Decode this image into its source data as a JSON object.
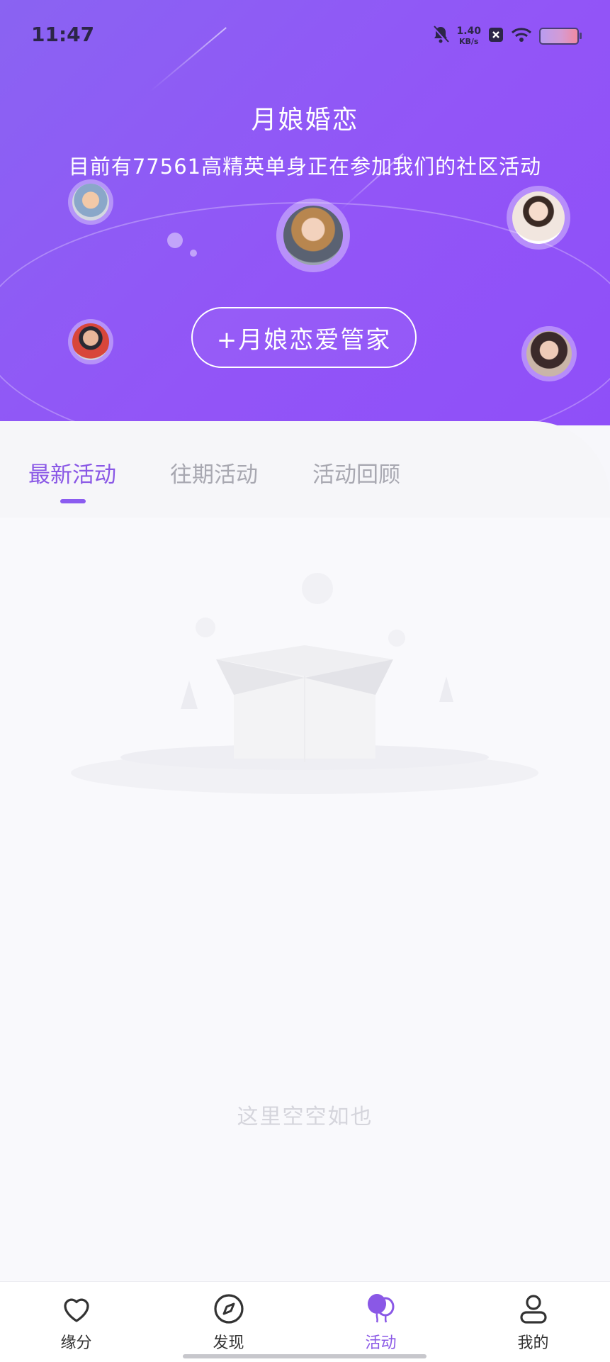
{
  "status_bar": {
    "time": "11:47",
    "net_speed_value": "1.40",
    "net_speed_unit": "KB/s",
    "icons": [
      "bell-off-icon",
      "box-x-icon",
      "wifi-icon",
      "battery-icon"
    ]
  },
  "hero": {
    "title": "月娘婚恋",
    "subtitle": "目前有77561高精英单身正在参加我们的社区活动",
    "cta_label": "+月娘恋爱管家",
    "background_color": "#9057f6"
  },
  "tabs": [
    {
      "label": "最新活动",
      "active": true
    },
    {
      "label": "往期活动",
      "active": false
    },
    {
      "label": "活动回顾",
      "active": false
    }
  ],
  "empty_state": {
    "message": "这里空空如也",
    "icon": "empty-box-icon"
  },
  "bottom_nav": [
    {
      "label": "缘分",
      "icon": "heart-icon",
      "active": false
    },
    {
      "label": "发现",
      "icon": "compass-icon",
      "active": false
    },
    {
      "label": "活动",
      "icon": "balloon-icon",
      "active": true
    },
    {
      "label": "我的",
      "icon": "user-icon",
      "active": false
    }
  ],
  "colors": {
    "accent": "#8a58e6",
    "inactive_tab": "#a8a8b1",
    "panel_background": "#f6f6f9"
  }
}
